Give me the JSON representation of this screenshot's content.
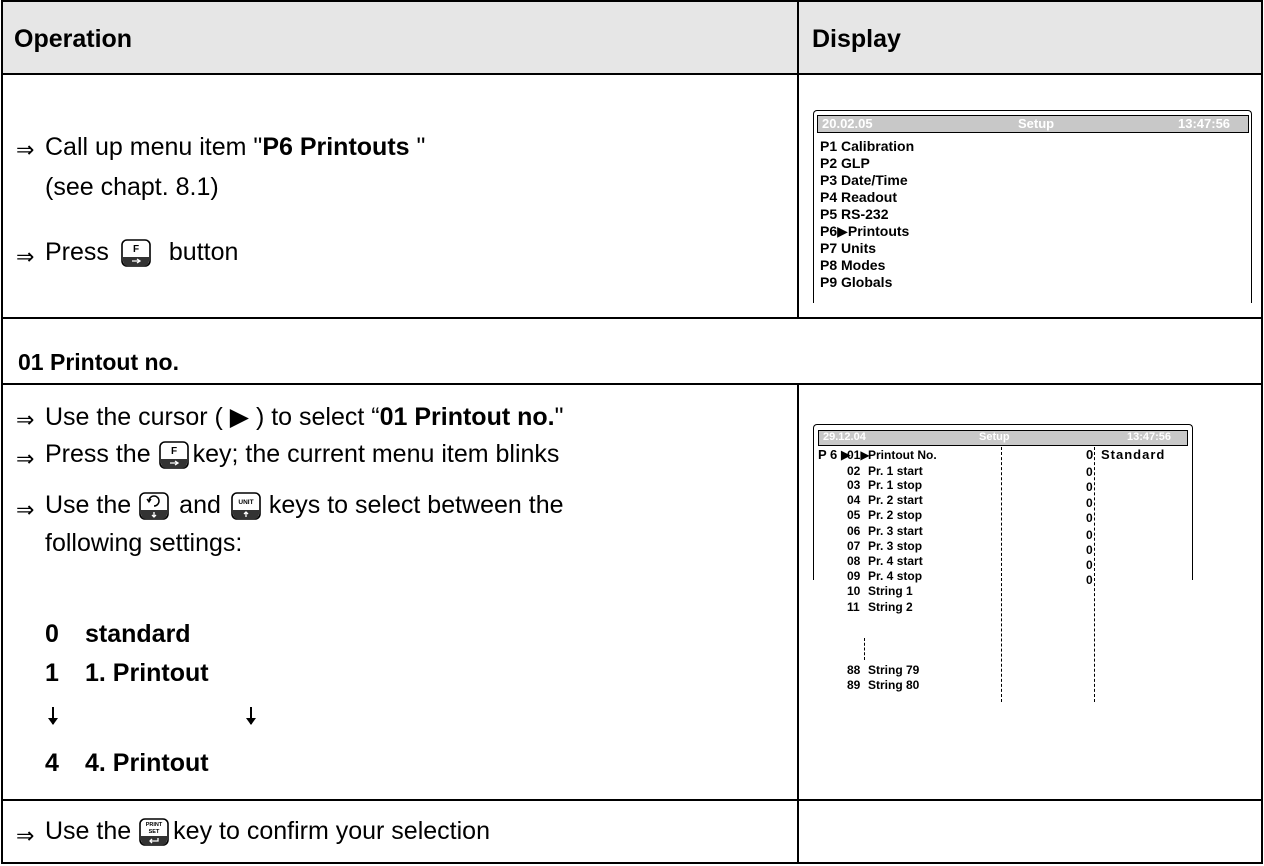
{
  "header": {
    "operation": "Operation",
    "display": "Display"
  },
  "row1": {
    "step1_prefix": "Call up menu item \"",
    "step1_bold": "P6 Printouts",
    "step1_suffix": " \"",
    "step1_line2": "(see chapt. 8.1)",
    "step2_prefix": "Press",
    "step2_key_icon": "f-key-icon",
    "step2_suffix": "button"
  },
  "display1": {
    "date": "20.02.05",
    "title": "Setup",
    "time": "13:47:56",
    "menu": [
      "P1  Calibration",
      "P2  GLP",
      "P3  Date/Time",
      "P4  Readout",
      "P5  RS-232",
      "P6▶Printouts",
      "P7  Units",
      "P8  Modes",
      "P9  Globals"
    ]
  },
  "section": {
    "title": "01 Printout no."
  },
  "row2": {
    "step1_prefix": "Use the cursor ( ▶ ) to select “",
    "step1_bold": "01 Printout no.",
    "step1_suffix": "\"",
    "step2_prefix": "Press the",
    "step2_suffix": "key; the current menu item blinks",
    "step3_prefix": "Use the",
    "step3_mid": "and",
    "step3_suffix": "keys to select between the",
    "step3_line2": "following settings:",
    "options": [
      {
        "num": "0",
        "label": "standard"
      },
      {
        "num": "1",
        "label": "1. Printout"
      },
      {
        "num": "4",
        "label": "4. Printout"
      }
    ],
    "down_arrow": "🡫"
  },
  "display2": {
    "date": "29.12.04",
    "title": "Setup",
    "time": "13:47:56",
    "prefix": "P 6 ▶",
    "rows": [
      {
        "code": "01▶",
        "label": "Printout No.",
        "value": "0",
        "extra": "Standard"
      },
      {
        "code": "02",
        "label": "Pr. 1 start",
        "value": "0",
        "extra": ""
      },
      {
        "code": "03",
        "label": "Pr. 1 stop",
        "value": "0",
        "extra": ""
      },
      {
        "code": "04",
        "label": "Pr. 2 start",
        "value": "0",
        "extra": ""
      },
      {
        "code": "05",
        "label": "Pr. 2 stop",
        "value": "0",
        "extra": ""
      },
      {
        "code": "06",
        "label": "Pr. 3 start",
        "value": "0",
        "extra": ""
      },
      {
        "code": "07",
        "label": "Pr. 3 stop",
        "value": "0",
        "extra": ""
      },
      {
        "code": "08",
        "label": "Pr. 4 start",
        "value": "0",
        "extra": ""
      },
      {
        "code": "09",
        "label": "Pr. 4 stop",
        "value": "0",
        "extra": ""
      },
      {
        "code": "10",
        "label": "String 1",
        "value": "",
        "extra": ""
      },
      {
        "code": "11",
        "label": " String 2",
        "value": "",
        "extra": ""
      },
      {
        "code": "88",
        "label": "String 79",
        "value": "",
        "extra": ""
      },
      {
        "code": "89",
        "label": "String 80",
        "value": "",
        "extra": ""
      }
    ]
  },
  "row3": {
    "step_prefix": "Use the",
    "step_suffix": "key to confirm your selection"
  },
  "icons": {
    "bullet": "⇒"
  }
}
